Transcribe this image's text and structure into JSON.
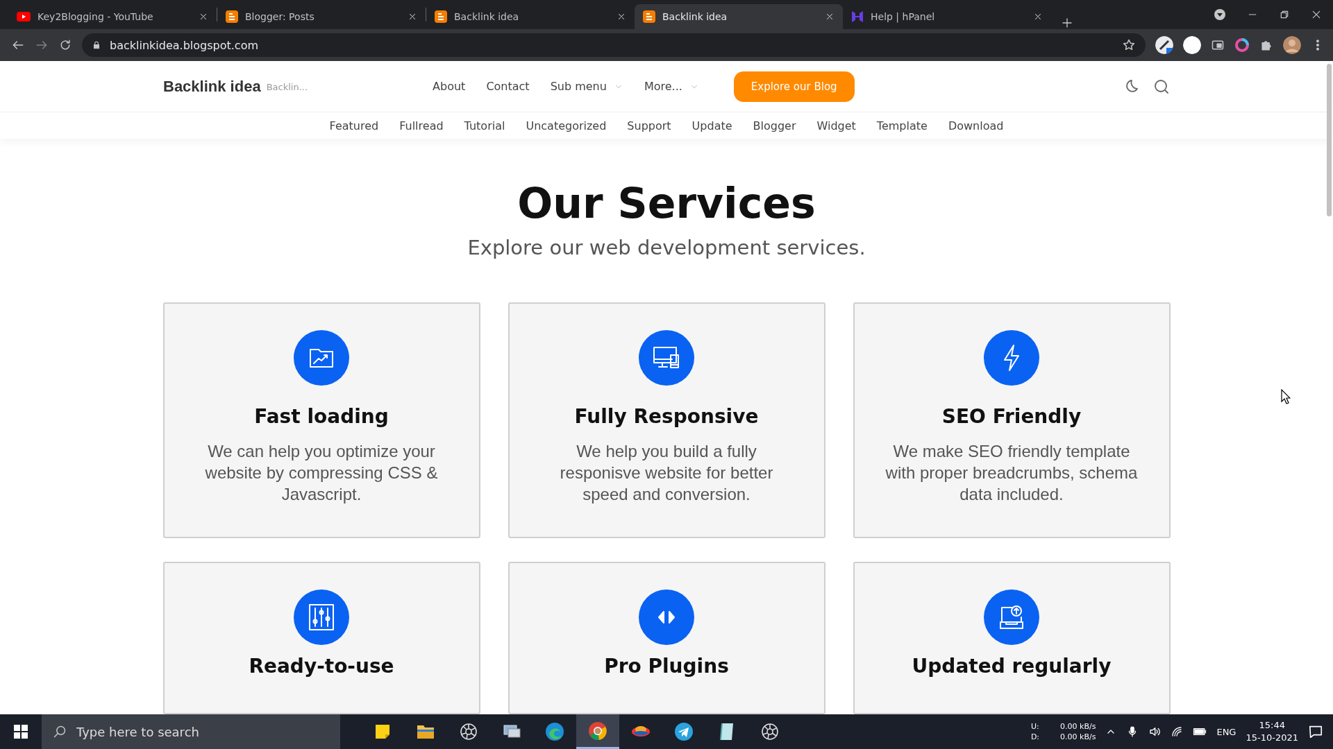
{
  "browser": {
    "tabs": [
      {
        "title": "Key2Blogging - YouTube",
        "kind": "youtube",
        "selected": false
      },
      {
        "title": "Blogger: Posts",
        "kind": "blogger",
        "selected": false
      },
      {
        "title": "Backlink idea",
        "kind": "blogger",
        "selected": false
      },
      {
        "title": "Backlink idea",
        "kind": "blogger",
        "selected": true
      },
      {
        "title": "Help | hPanel",
        "kind": "hpanel",
        "selected": false
      }
    ],
    "address": "backlinkidea.blogspot.com"
  },
  "site": {
    "logo": "Backlink idea",
    "tagline": "Backlin...",
    "nav": [
      {
        "label": "About",
        "dropdown": false
      },
      {
        "label": "Contact",
        "dropdown": false
      },
      {
        "label": "Sub menu",
        "dropdown": true
      },
      {
        "label": "More...",
        "dropdown": true
      }
    ],
    "cta": "Explore our Blog",
    "categories": [
      "Featured",
      "Fullread",
      "Tutorial",
      "Uncategorized",
      "Support",
      "Update",
      "Blogger",
      "Widget",
      "Template",
      "Download"
    ]
  },
  "services": {
    "title": "Our Services",
    "subtitle": "Explore our web development services.",
    "cards": [
      {
        "kind": "folder-chart",
        "title": "Fast loading",
        "text": "We can help you optimize your website by compressing CSS & Javascript."
      },
      {
        "kind": "devices",
        "title": "Fully Responsive",
        "text": "We help you build a fully responisve website for better speed and conversion."
      },
      {
        "kind": "bolt",
        "title": "SEO Friendly",
        "text": "We make SEO friendly template with proper breadcrumbs, schema data included."
      },
      {
        "kind": "sliders",
        "title": "Ready-to-use"
      },
      {
        "kind": "code",
        "title": "Pro Plugins"
      },
      {
        "kind": "upload",
        "title": "Updated regularly"
      }
    ]
  },
  "taskbar": {
    "search_placeholder": "Type here to search",
    "apps": [
      {
        "kind": "notes",
        "selected": false
      },
      {
        "kind": "folder",
        "selected": false
      },
      {
        "kind": "aperture",
        "selected": false
      },
      {
        "kind": "computer",
        "selected": false
      },
      {
        "kind": "edge",
        "selected": false
      },
      {
        "kind": "chrome",
        "selected": true
      },
      {
        "kind": "disc",
        "selected": false
      },
      {
        "kind": "telegram",
        "selected": false
      },
      {
        "kind": "notepad",
        "selected": false
      },
      {
        "kind": "aperture",
        "selected": false
      }
    ],
    "upload_label": "U:",
    "download_label": "D:",
    "upload_rate": "0.00 kB/s",
    "download_rate": "0.00 kB/s",
    "language": "ENG",
    "time": "15:44",
    "date": "15-10-2021"
  }
}
